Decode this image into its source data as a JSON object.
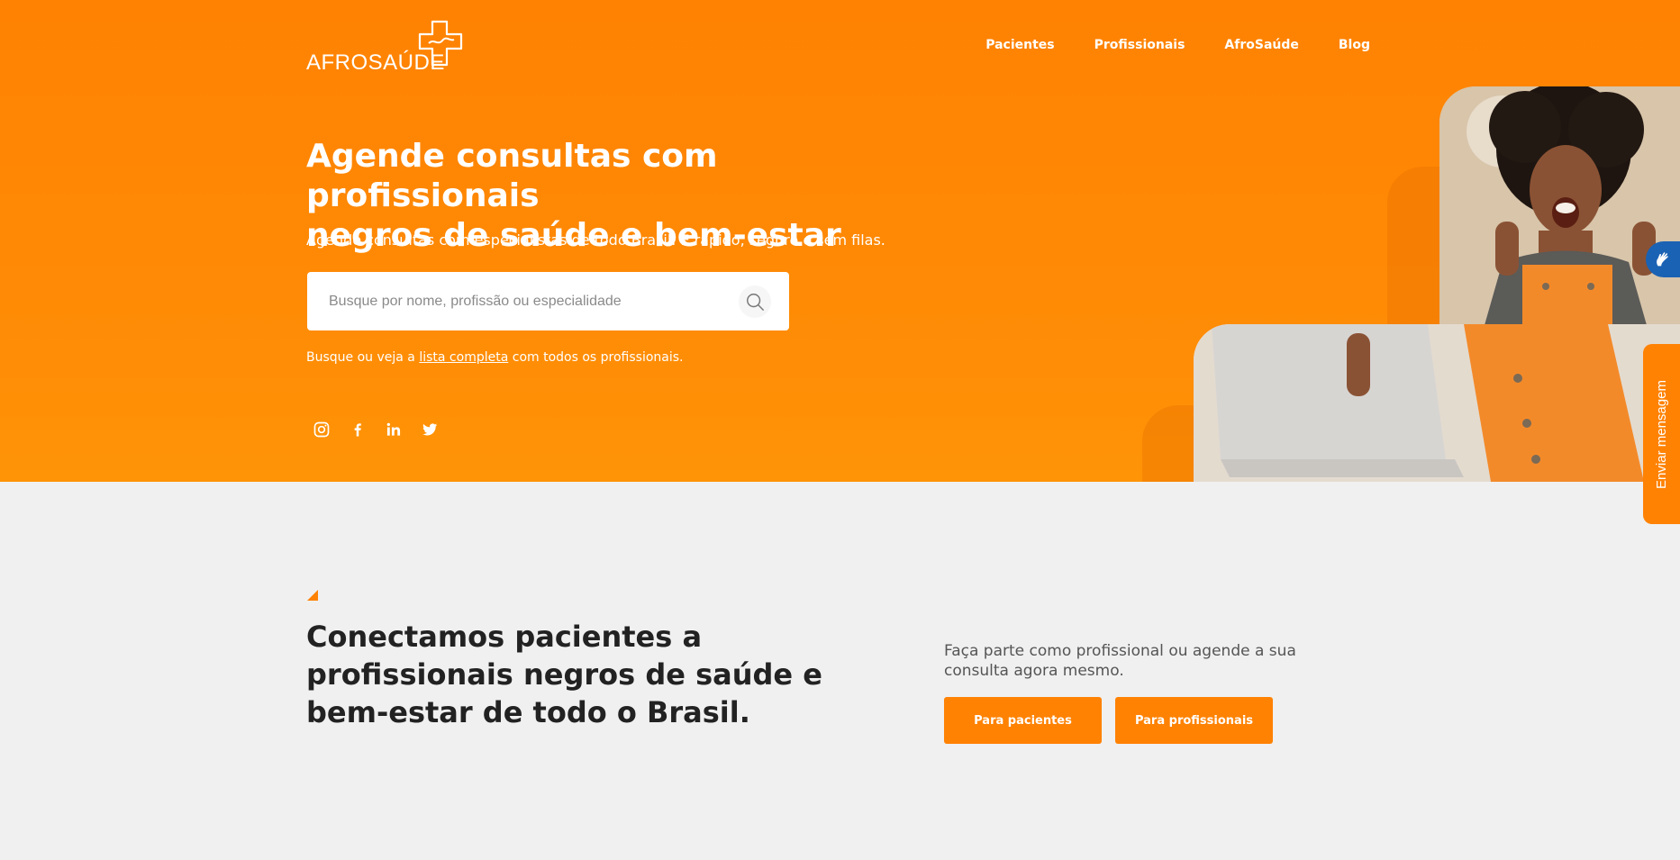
{
  "header": {
    "logo_text": "AFROSAÚDE",
    "nav": [
      "Pacientes",
      "Profissionais",
      "AfroSaúde",
      "Blog"
    ]
  },
  "hero": {
    "title_line1": "Agende consultas com profissionais",
    "title_line2": "negros de saúde e bem-estar",
    "subtitle": "Agende consultas com especialistas de todo Brasil. É rápido, seguro e sem filas.",
    "search_placeholder": "Busque por nome, profissão ou especialidade",
    "note_prefix": "Busque ou veja a ",
    "note_link": "lista completa",
    "note_suffix": " com todos os profissionais.",
    "social": [
      "instagram-icon",
      "facebook-icon",
      "linkedin-icon",
      "twitter-icon"
    ]
  },
  "widgets": {
    "send_message": "Enviar mensagem"
  },
  "section": {
    "title": "Conectamos pacientes a profissionais negros de saúde e bem-estar de todo o Brasil.",
    "text": "Faça parte como profissional ou agende a sua consulta agora mesmo.",
    "btn_patients": "Para pacientes",
    "btn_professionals": "Para profissionais"
  },
  "colors": {
    "brand_orange": "#ff8203",
    "background": "#f0f0f0",
    "libras_blue": "#1a62b4"
  }
}
